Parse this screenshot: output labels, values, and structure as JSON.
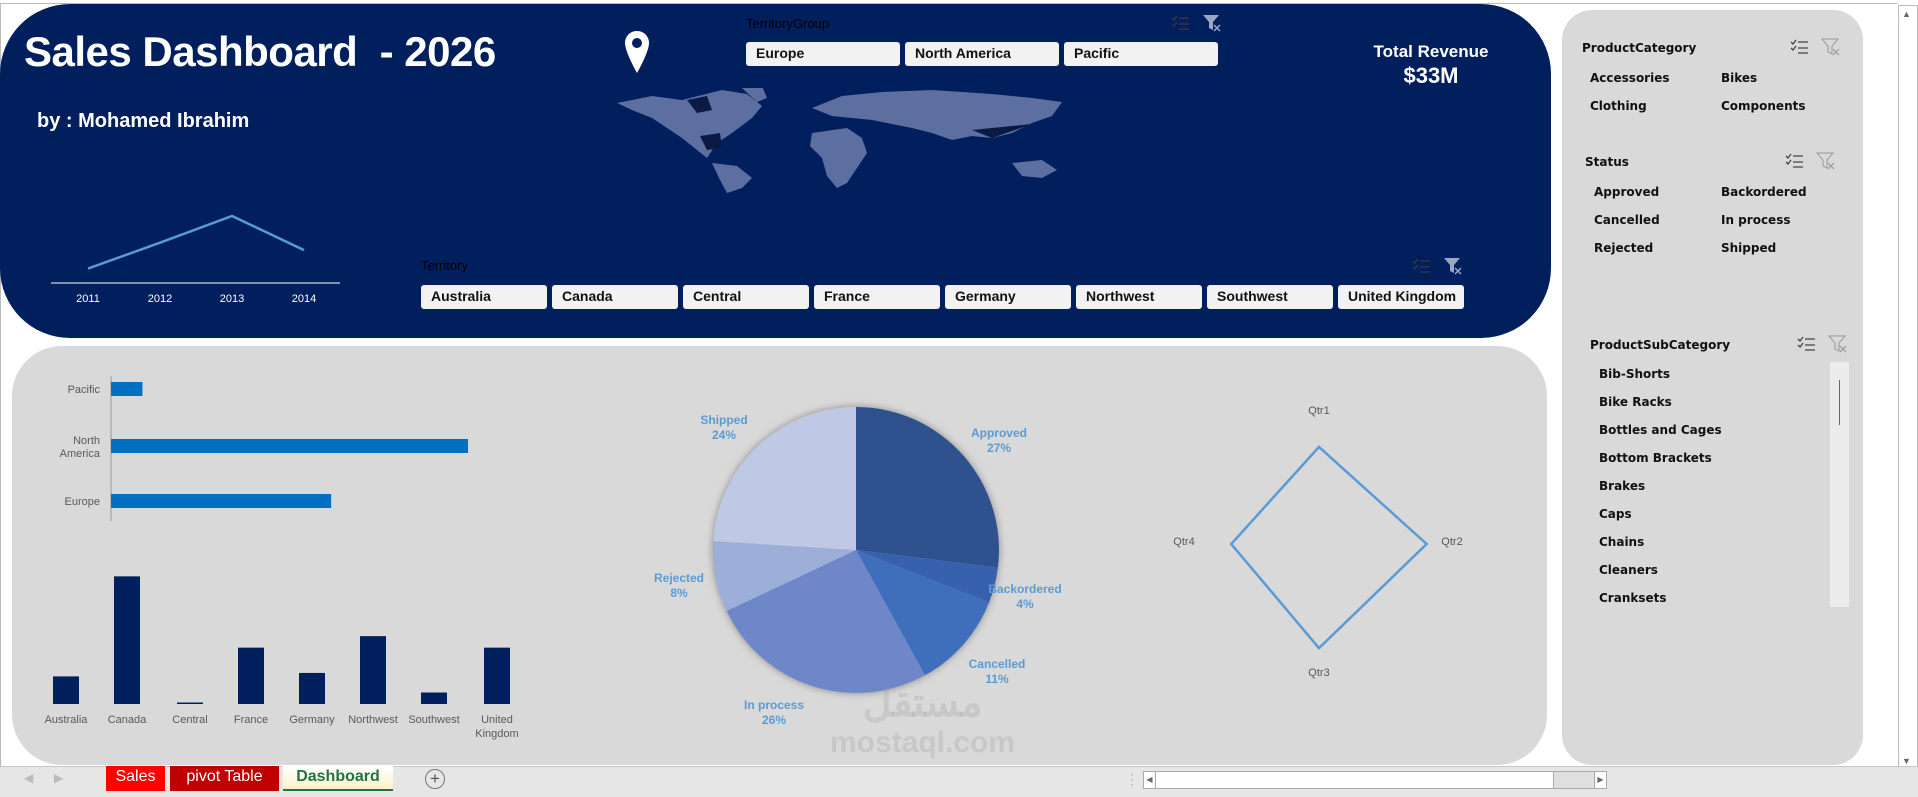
{
  "header": {
    "title": "Sales Dashboard  - 2026",
    "author": "by : Mohamed Ibrahim"
  },
  "revenue": {
    "label": "Total Revenue",
    "value": "$33M"
  },
  "territory_group": {
    "label": "TerritoryGroup",
    "items": [
      "Europe",
      "North America",
      "Pacific"
    ]
  },
  "territory": {
    "label": "Territory",
    "items": [
      "Australia",
      "Canada",
      "Central",
      "France",
      "Germany",
      "Northwest",
      "Southwest",
      "United Kingdom"
    ]
  },
  "product_category": {
    "label": "ProductCategory",
    "items": [
      "Accessories",
      "Bikes",
      "Clothing",
      "Components"
    ]
  },
  "status": {
    "label": "Status",
    "items": [
      "Approved",
      "Backordered",
      "Cancelled",
      "In process",
      "Rejected",
      "Shipped"
    ]
  },
  "product_subcategory": {
    "label": "ProductSubCategory",
    "items": [
      "Bib-Shorts",
      "Bike Racks",
      "Bottles and Cages",
      "Bottom Brackets",
      "Brakes",
      "Caps",
      "Chains",
      "Cleaners",
      "Cranksets"
    ]
  },
  "sheet_tabs": [
    {
      "label": "Sales",
      "color": "#ff0000"
    },
    {
      "label": "pivot Table",
      "color": "#c00000"
    },
    {
      "label": "Dashboard",
      "active": true
    }
  ],
  "watermark": {
    "arabic": "مستقل",
    "latin": "mostaql.com"
  },
  "colors": {
    "navy": "#001f5c",
    "panel": "#d9d9d9",
    "accent": "#5b9bd5",
    "bar": "#0070c0"
  },
  "chart_data": [
    {
      "type": "line",
      "title": "Revenue by Year",
      "categories": [
        "2011",
        "2012",
        "2013",
        "2014"
      ],
      "values": [
        1,
        4.5,
        8.1,
        3.5
      ]
    },
    {
      "type": "bar",
      "orientation": "horizontal",
      "title": "Revenue by Territory Group",
      "categories": [
        "Pacific",
        "North America",
        "Europe"
      ],
      "values": [
        1.7,
        19.3,
        11.9
      ]
    },
    {
      "type": "bar",
      "title": "Revenue by Territory",
      "categories": [
        "Australia",
        "Canada",
        "Central",
        "France",
        "Germany",
        "Northwest",
        "Southwest",
        "United Kingdom"
      ],
      "values": [
        2.4,
        11.1,
        0.1,
        4.9,
        2.7,
        5.9,
        1.0,
        4.9
      ]
    },
    {
      "type": "pie",
      "title": "Orders by Status",
      "categories": [
        "Approved",
        "Backordered",
        "Cancelled",
        "In process",
        "Rejected",
        "Shipped"
      ],
      "values": [
        27,
        4,
        11,
        26,
        8,
        24
      ],
      "labels": [
        "27%",
        "4%",
        "11%",
        "26%",
        "8%",
        "24%"
      ],
      "colors": [
        "#2f528f",
        "#3760ad",
        "#3f6fbb",
        "#6d87c9",
        "#9dafd8",
        "#bfc9e5"
      ]
    },
    {
      "type": "radar",
      "title": "Revenue by Quarter",
      "categories": [
        "Qtr1",
        "Qtr2",
        "Qtr3",
        "Qtr4"
      ],
      "values": [
        8.3,
        9.2,
        8.9,
        7.5
      ]
    }
  ]
}
